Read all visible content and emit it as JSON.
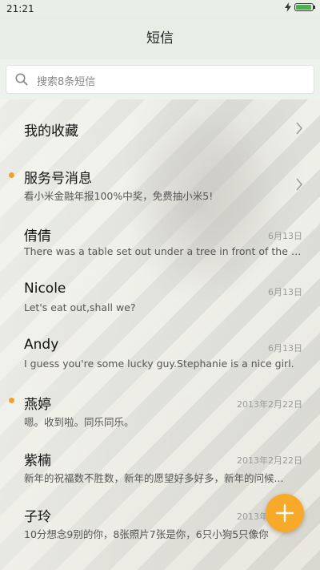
{
  "status_bar": {
    "time": "21:21",
    "charging_icon": "lightning-icon",
    "battery_icon": "battery-icon",
    "battery_level": 0.9
  },
  "header": {
    "title": "短信"
  },
  "search": {
    "placeholder": "搜索8条短信",
    "icon": "search-icon"
  },
  "colors": {
    "accent": "#f7a929",
    "unread_dot": "#f0a32c"
  },
  "favorites": {
    "label": "我的收藏",
    "icon": "chevron-right-icon"
  },
  "service": {
    "label": "服务号消息",
    "preview": "看小米金融年报100%中奖，免费抽小米5!",
    "unread": true,
    "icon": "chevron-right-icon"
  },
  "conversations": [
    {
      "name": "倩倩",
      "date": "6月13日",
      "preview": "There was a table set out under a tree in front of the ho...",
      "unread": false
    },
    {
      "name": "Nicole",
      "date": "6月13日",
      "preview": "Let's eat out,shall we?",
      "unread": false
    },
    {
      "name": "Andy",
      "date": "6月13日",
      "preview": "I guess you're some lucky guy.Stephanie is a nice girl.",
      "unread": false
    },
    {
      "name": "燕婷",
      "date": "2013年2月22日",
      "preview": "嗯。收到啦。同乐同乐。",
      "unread": true
    },
    {
      "name": "紫楠",
      "date": "2013年2月22日",
      "preview": "新年的祝福数不胜数，新年的愿望好多好多，新年的问候...",
      "unread": false
    },
    {
      "name": "子玲",
      "date": "2013年2月22日",
      "preview": "10分想念9别的你，8张照片7张是你，6只小狗5只像你",
      "unread": false
    }
  ],
  "fab": {
    "icon": "plus-icon"
  }
}
